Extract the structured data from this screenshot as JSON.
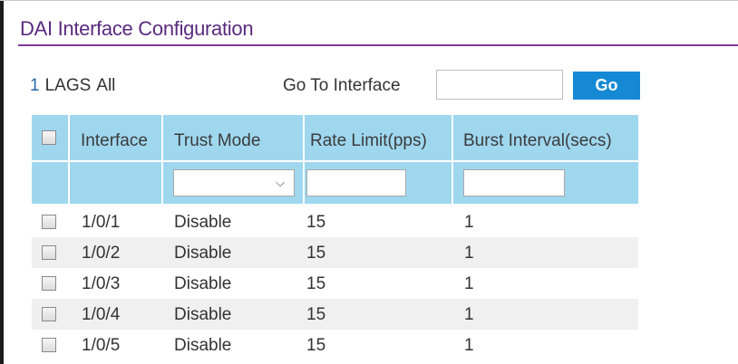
{
  "title": "DAI Interface Configuration",
  "filter": {
    "num": "1",
    "lags": "LAGS",
    "all": "All"
  },
  "goto": {
    "label": "Go To Interface",
    "value": "",
    "button": "Go"
  },
  "table": {
    "headers": [
      "Interface",
      "Trust Mode",
      "Rate Limit(pps)",
      "Burst Interval(secs)"
    ],
    "rows": [
      {
        "interface": "1/0/1",
        "trust_mode": "Disable",
        "rate_limit": "15",
        "burst_interval": "1"
      },
      {
        "interface": "1/0/2",
        "trust_mode": "Disable",
        "rate_limit": "15",
        "burst_interval": "1"
      },
      {
        "interface": "1/0/3",
        "trust_mode": "Disable",
        "rate_limit": "15",
        "burst_interval": "1"
      },
      {
        "interface": "1/0/4",
        "trust_mode": "Disable",
        "rate_limit": "15",
        "burst_interval": "1"
      },
      {
        "interface": "1/0/5",
        "trust_mode": "Disable",
        "rate_limit": "15",
        "burst_interval": "1"
      }
    ]
  },
  "colors": {
    "title": "#5a2a7e",
    "accent_button": "#1689d4",
    "header_bg": "#9fd7ef",
    "link": "#2a6aa8"
  }
}
